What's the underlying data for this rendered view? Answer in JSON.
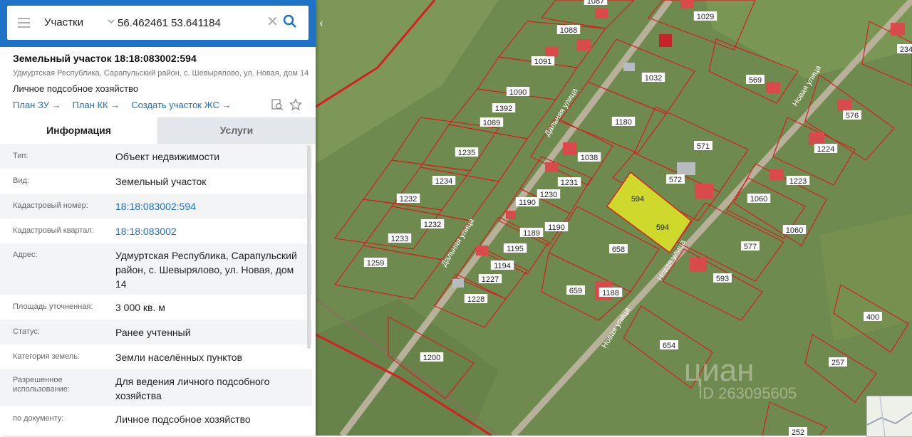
{
  "search": {
    "layer": "Участки",
    "query": "56.462461 53.641184",
    "clear_glyph": "✕",
    "collapse_glyph": "‹"
  },
  "card": {
    "title": "Земельный участок 18:18:083002:594",
    "address": "Удмуртская Республика, Сарапульский район, с. Шевырялово, ул. Новая, дом 14",
    "use": "Личное подсобное хозяйство",
    "links": [
      "План ЗУ →",
      "План КК →",
      "Создать участок ЖС →"
    ]
  },
  "tabs": [
    "Информация",
    "Услуги"
  ],
  "info_rows": [
    {
      "label": "Тип:",
      "value": "Объект недвижимости"
    },
    {
      "label": "Вид:",
      "value": "Земельный участок"
    },
    {
      "label": "Кадастровый номер:",
      "value": "18:18:083002:594"
    },
    {
      "label": "Кадастровый квартал:",
      "value": "18:18:083002"
    },
    {
      "label": "Адрес:",
      "value": "Удмуртская Республика, Сарапульский район, с. Шевырялово, ул. Новая, дом 14"
    },
    {
      "label": "Площадь уточненная:",
      "value": "3 000 кв. м"
    },
    {
      "label": "Статус:",
      "value": "Ранее учтенный"
    },
    {
      "label": "Категория земель:",
      "value": "Земли населённых пунктов"
    },
    {
      "label": "Разрешенное использование:",
      "value": "Для ведения личного подсобного хозяйства"
    },
    {
      "label": "по документу:",
      "value": "Личное подсобное хозяйство"
    }
  ],
  "map": {
    "streets": [
      "Дальняя улица",
      "Дальняя улица",
      "Новая улица",
      "Новая улица",
      "Новая улица"
    ],
    "parcel_labels": [
      "1087",
      "1029",
      "1088",
      "1091",
      "1032",
      "569",
      "1090",
      "1392",
      "1180",
      "576",
      "1089",
      "1235",
      "1038",
      "571",
      "1224",
      "1231",
      "572",
      "1223",
      "1234",
      "594",
      "1060",
      "1232",
      "1230",
      "1190",
      "1060",
      "1232",
      "1190",
      "1189",
      "1233",
      "1195",
      "658",
      "577",
      "1259",
      "1194",
      "1227",
      "593",
      "1228",
      "659",
      "1188",
      "400",
      "654",
      "1200",
      "257",
      "252",
      "234",
      "594"
    ],
    "watermark": "циан",
    "watermark_id": "ID 263095605",
    "colors": {
      "boundary": "#d42020",
      "selected": "#d7e02a",
      "road": "#b8b199",
      "field": "#6f8a4e"
    }
  },
  "icons": [
    "menu-icon",
    "chevron-down-icon",
    "clear-icon",
    "search-icon",
    "collapse-icon",
    "map-search-icon",
    "star-icon"
  ]
}
